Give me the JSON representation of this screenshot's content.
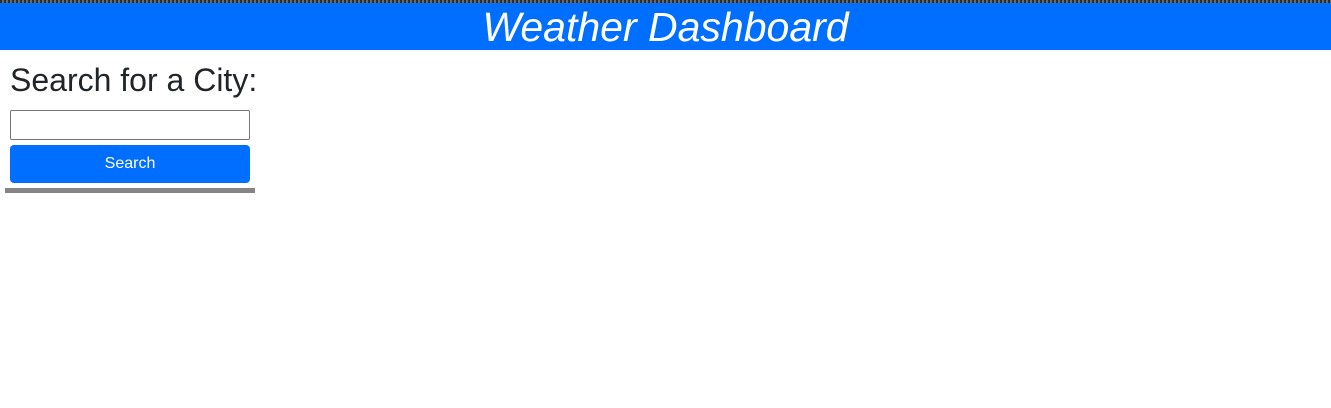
{
  "header": {
    "title": "Weather Dashboard"
  },
  "search": {
    "heading": "Search for a City:",
    "input_value": "",
    "placeholder": "",
    "button_label": "Search"
  },
  "colors": {
    "primary": "#006eff",
    "text": "#212529",
    "divider": "#858585"
  }
}
